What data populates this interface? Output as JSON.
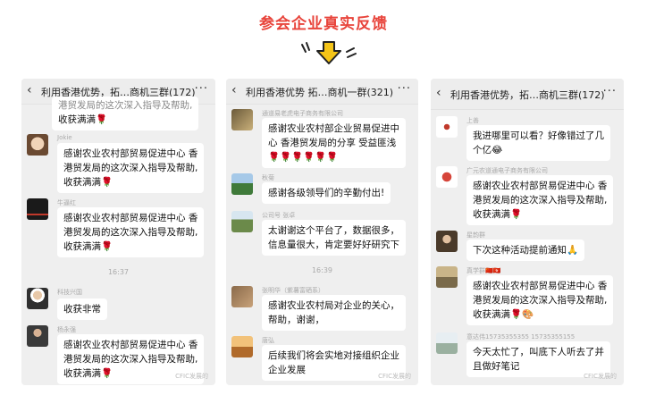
{
  "page_title": "参会企业真实反馈",
  "panels": [
    {
      "chat_title": "利用香港优势，拓…商机三群(172)",
      "partial_top": "收获满满🌹",
      "partial_top_prev": "港贸发局的这次深入指导及帮助,",
      "messages": [
        {
          "sender": "Jokie",
          "lines": [
            "感谢农业农村部贸易促进中心 香",
            "港贸发局的这次深入指导及帮助,",
            "收获满满🌹"
          ]
        },
        {
          "sender": "牛逼红",
          "lines": [
            "感谢农业农村部贸易促进中心 香",
            "港贸发局的这次深入指导及帮助,",
            "收获满满🌹"
          ]
        },
        {
          "sender": "科技兴国",
          "lines": [
            "收获非常"
          ]
        },
        {
          "sender": "杨永强",
          "lines": [
            "感谢农业农村部贸易促进中心 香",
            "港贸发局的这次深入指导及帮助,",
            "收获满满🌹"
          ]
        }
      ],
      "time": "16:37",
      "watermark": "CFIC发展的"
    },
    {
      "chat_title": "利用香港优势 拓…商机一群(321)",
      "messages": [
        {
          "sender": "通道易老虎电子商务有限公司",
          "lines": [
            "感谢农业农村部企业贸易促进中",
            "心 香港贸发局的分享 受益匪浅",
            "🌹🌹🌹🌹🌹🌹"
          ]
        },
        {
          "sender": "秋菊",
          "lines": [
            "感谢各级领导们的辛勤付出!"
          ]
        },
        {
          "sender": "公司号 张卓",
          "lines": [
            "太谢谢这个平台了，数据很多，",
            "信息量很大，肯定要好好研究下"
          ]
        },
        {
          "sender": "张明华（紫薯富硒系）",
          "lines": [
            "感谢农业农村局对企业的关心，",
            "帮助，谢谢，"
          ]
        },
        {
          "sender": "唐弘",
          "lines": [
            "后续我们将会实地对接组织企业",
            "企业发展"
          ]
        }
      ],
      "time": "16:39",
      "watermark": "CFIC发展的"
    },
    {
      "chat_title": "利用香港优势，拓…商机三群(172)",
      "messages": [
        {
          "sender": "上善",
          "lines": [
            "我进哪里可以看？好像错过了几",
            "个亿😂"
          ]
        },
        {
          "sender": "广元农道通电子商务有限公司",
          "lines": [
            "感谢农业农村部贸易促进中心 香",
            "港贸发局的这次深入指导及帮助,",
            "收获满满🌹"
          ]
        },
        {
          "sender": "星韵群",
          "lines": [
            "下次这种活动提前通知🙏"
          ]
        },
        {
          "sender": "真学群🇨🇳🇭🇰",
          "lines": [
            "感谢农业农村部贸易促进中心 香",
            "港贸发局的这次深入指导及帮助,",
            "收获满满🌹🎨"
          ]
        },
        {
          "sender": "意达伟15735355355 15735355155",
          "lines": [
            "今天太忙了，叫底下人听去了并",
            "且做好笔记"
          ]
        }
      ],
      "watermark": "CFIC发展的"
    }
  ]
}
